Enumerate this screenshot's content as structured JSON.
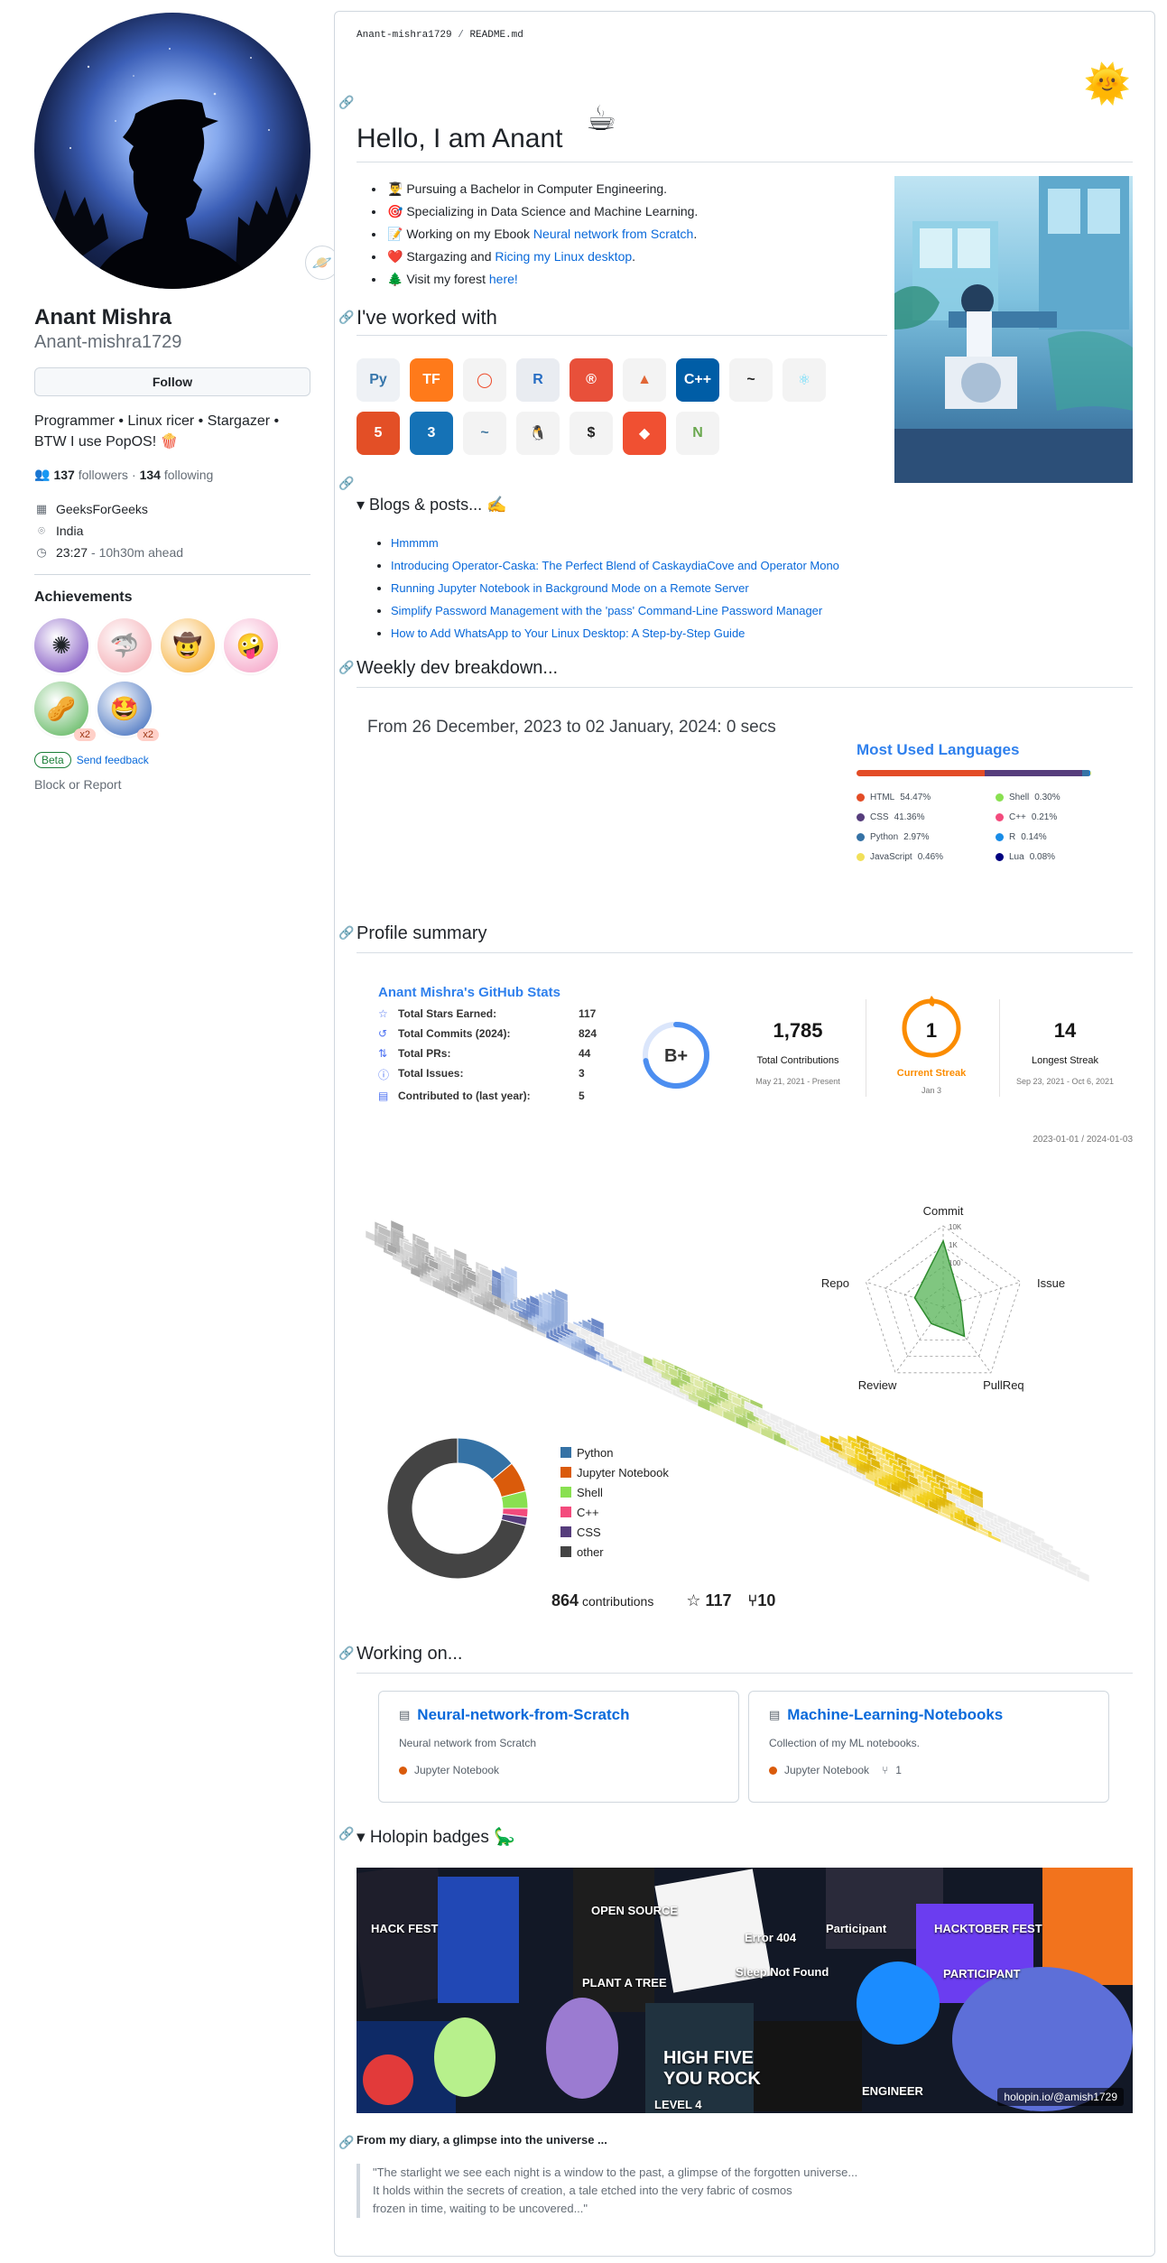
{
  "profile": {
    "display_name": "Anant Mishra",
    "login": "Anant-mishra1729",
    "follow_label": "Follow",
    "bio": "Programmer • Linux ricer • Stargazer • BTW I use PopOS! 🍿",
    "followers_count": "137",
    "followers_label": "followers",
    "following_count": "134",
    "following_label": "following",
    "organization": "GeeksForGeeks",
    "location": "India",
    "local_time": "23:27",
    "time_offset": "- 10h30m ahead",
    "achievements_title": "Achievements",
    "achievements": [
      {
        "icon": "galaxy-brain-icon",
        "color": "#6d3bb8"
      },
      {
        "icon": "pull-shark-icon",
        "color": "#f2a0a8"
      },
      {
        "icon": "quickdraw-icon",
        "color": "#f5a623"
      },
      {
        "icon": "yolo-icon",
        "color": "#f49ac1"
      },
      {
        "icon": "pair-extraordinaire-icon",
        "color": "#4cae4c",
        "multiplier": "x2"
      },
      {
        "icon": "starstruck-icon",
        "color": "#2d5fb7",
        "multiplier": "x2"
      }
    ],
    "beta_label": "Beta",
    "send_feedback": "Send feedback",
    "block_report": "Block or Report"
  },
  "readme": {
    "path_user": "Anant-mishra1729",
    "path_sep": " / ",
    "path_file": "README.md",
    "greeting": "Hello, I am Anant",
    "intro": [
      {
        "emoji": "👨‍🎓",
        "text": "Pursuing a Bachelor in Computer Engineering."
      },
      {
        "emoji": "🎯",
        "text": "Specializing in Data Science and Machine Learning."
      },
      {
        "emoji": "📝",
        "text": "Working on my Ebook ",
        "link": "Neural network from Scratch",
        "tail": "."
      },
      {
        "emoji": "❤️",
        "text": "Stargazing and ",
        "link": "Ricing my Linux desktop",
        "tail": "."
      },
      {
        "emoji": "🌲",
        "text": "Visit my forest ",
        "link": "here!",
        "tail": ""
      }
    ],
    "worked_with_heading": "I've worked with",
    "skills": [
      {
        "icon": "python-icon",
        "glyph": "Py",
        "bg": "#eef1f5",
        "fg": "#3776ab"
      },
      {
        "icon": "tensorflow-icon",
        "glyph": "TF",
        "bg": "#ff7a1a",
        "fg": "#ffffff"
      },
      {
        "icon": "pytorch-icon",
        "glyph": "◯",
        "bg": "#f3f3f3",
        "fg": "#ee4c2c"
      },
      {
        "icon": "r-icon",
        "glyph": "R",
        "bg": "#e9ecf1",
        "fg": "#276dc3"
      },
      {
        "icon": "rust-icon",
        "glyph": "®",
        "bg": "#e8503a",
        "fg": "#ffffff"
      },
      {
        "icon": "matlab-icon",
        "glyph": "▲",
        "bg": "#f3f3f3",
        "fg": "#e16737"
      },
      {
        "icon": "cpp-icon",
        "glyph": "C++",
        "bg": "#005da6",
        "fg": "#ffffff"
      },
      {
        "icon": "bash-icon",
        "glyph": "~",
        "bg": "#f3f3f3",
        "fg": "#222222"
      },
      {
        "icon": "react-icon",
        "glyph": "⚛",
        "bg": "#f3f3f3",
        "fg": "#61dafb"
      },
      {
        "icon": "html5-icon",
        "glyph": "5",
        "bg": "#e34f26",
        "fg": "#ffffff"
      },
      {
        "icon": "css3-icon",
        "glyph": "3",
        "bg": "#1572b6",
        "fg": "#ffffff"
      },
      {
        "icon": "mysql-icon",
        "glyph": "~",
        "bg": "#f3f3f3",
        "fg": "#4479a1"
      },
      {
        "icon": "linux-icon",
        "glyph": "🐧",
        "bg": "#f3f3f3",
        "fg": "#222222"
      },
      {
        "icon": "terminal-icon",
        "glyph": "$",
        "bg": "#f3f3f3",
        "fg": "#222222"
      },
      {
        "icon": "git-icon",
        "glyph": "◆",
        "bg": "#f05032",
        "fg": "#ffffff"
      },
      {
        "icon": "nodejs-icon",
        "glyph": "N",
        "bg": "#f3f3f3",
        "fg": "#6aa84f"
      }
    ],
    "blogs_heading": "Blogs & posts...",
    "blogs": [
      "Hmmmm",
      "Introducing Operator-Caska: The Perfect Blend of CaskaydiaCove and Operator Mono",
      "Running Jupyter Notebook in Background Mode on a Remote Server",
      "Simplify Password Management with the 'pass' Command-Line Password Manager",
      "How to Add WhatsApp to Your Linux Desktop: A Step-by-Step Guide"
    ],
    "weekly_heading": "Weekly dev breakdown...",
    "weekly_range": "From 26 December, 2023 to 02 January, 2024: 0 secs",
    "langs_title": "Most Used Languages",
    "langs": [
      {
        "name": "HTML",
        "pct": "54.47%",
        "value": 54.47,
        "color": "#e34c26"
      },
      {
        "name": "Shell",
        "pct": "0.30%",
        "value": 0.3,
        "color": "#89e051"
      },
      {
        "name": "CSS",
        "pct": "41.36%",
        "value": 41.36,
        "color": "#563d7c"
      },
      {
        "name": "C++",
        "pct": "0.21%",
        "value": 0.21,
        "color": "#f34b7d"
      },
      {
        "name": "Python",
        "pct": "2.97%",
        "value": 2.97,
        "color": "#3572a5"
      },
      {
        "name": "R",
        "pct": "0.14%",
        "value": 0.14,
        "color": "#198ce7"
      },
      {
        "name": "JavaScript",
        "pct": "0.46%",
        "value": 0.46,
        "color": "#f1e05a"
      },
      {
        "name": "Lua",
        "pct": "0.08%",
        "value": 0.08,
        "color": "#000080"
      }
    ],
    "summary_heading": "Profile summary",
    "stats_title": "Anant Mishra's GitHub Stats",
    "stats": [
      {
        "icon": "star-icon",
        "glyph": "☆",
        "label": "Total Stars Earned:",
        "value": "117"
      },
      {
        "icon": "history-icon",
        "glyph": "↺",
        "label": "Total Commits (2024):",
        "value": "824"
      },
      {
        "icon": "pull-request-icon",
        "glyph": "⇅",
        "label": "Total PRs:",
        "value": "44"
      },
      {
        "icon": "issue-icon",
        "glyph": "ⓘ",
        "label": "Total Issues:",
        "value": "3"
      },
      {
        "icon": "repo-icon",
        "glyph": "▤",
        "label": "Contributed to (last year):",
        "value": "5"
      }
    ],
    "grade": "B+",
    "grade_fraction": 0.72,
    "streak": {
      "total": "1,785",
      "total_label": "Total Contributions",
      "total_range": "May 21, 2021 - Present",
      "current": "1",
      "current_label": "Current Streak",
      "current_range": "Jan 3",
      "longest": "14",
      "longest_label": "Longest Streak",
      "longest_range": "Sep 23, 2021 - Oct 6, 2021"
    },
    "iso_range": "2023-01-01 / 2024-01-03",
    "radar_labels": [
      "Commit",
      "Issue",
      "PullReq",
      "Review",
      "Repo"
    ],
    "radar_ticks": [
      "10K",
      "1K",
      "100"
    ],
    "donut_legend": [
      {
        "name": "Python",
        "color": "#3572a5"
      },
      {
        "name": "Jupyter Notebook",
        "color": "#da5b0b"
      },
      {
        "name": "Shell",
        "color": "#89e051"
      },
      {
        "name": "C++",
        "color": "#f34b7d"
      },
      {
        "name": "CSS",
        "color": "#563d7c"
      },
      {
        "name": "other",
        "color": "#444444"
      }
    ],
    "contributions": "864",
    "contributions_label": "contributions",
    "stars": "117",
    "forks": "10",
    "working_heading": "Working on...",
    "repos": [
      {
        "name": "Neural-network-from-Scratch",
        "desc": "Neural network from Scratch",
        "lang": "Jupyter Notebook",
        "lang_color": "#da5b0b",
        "forks": ""
      },
      {
        "name": "Machine-Learning-Notebooks",
        "desc": "Collection of my ML notebooks.",
        "lang": "Jupyter Notebook",
        "lang_color": "#da5b0b",
        "forks": "1"
      }
    ],
    "holopin_heading": "Holopin badges",
    "holopin_credit": "holopin.io/@amish1729",
    "holopin_stickers": [
      "HACK FEST",
      "OPEN SOURCE",
      "Error 404",
      "Sleep Not Found",
      "HIGH FIVE YOU ROCK",
      "HACKTOBER FEST",
      "PARTICIPANT",
      "Participant",
      "LEVEL 4",
      "ENGINEER",
      "PLANT A TREE"
    ],
    "diary_title": "From my diary, a glimpse into the universe ...",
    "diary_lines": [
      "\"The starlight we see each night is a window to the past, a glimpse of the forgotten universe...",
      "It holds within the secrets of creation, a tale etched into the very fabric of cosmos",
      "frozen in time, waiting to be uncovered...\""
    ]
  },
  "chart_data": [
    {
      "type": "bar",
      "title": "Most Used Languages",
      "categories": [
        "HTML",
        "CSS",
        "Python",
        "JavaScript",
        "Shell",
        "C++",
        "R",
        "Lua"
      ],
      "values": [
        54.47,
        41.36,
        2.97,
        0.46,
        0.3,
        0.21,
        0.14,
        0.08
      ],
      "unit": "%"
    },
    {
      "type": "radar",
      "axes": [
        "Commit",
        "Issue",
        "PullReq",
        "Review",
        "Repo"
      ],
      "scale": "log",
      "tick_labels": [
        "100",
        "1K",
        "10K"
      ],
      "values": [
        1800,
        8,
        60,
        10,
        30
      ]
    },
    {
      "type": "pie",
      "categories": [
        "Python",
        "Jupyter Notebook",
        "Shell",
        "C++",
        "CSS",
        "other"
      ],
      "values": [
        14,
        7,
        4,
        2,
        2,
        71
      ]
    }
  ]
}
